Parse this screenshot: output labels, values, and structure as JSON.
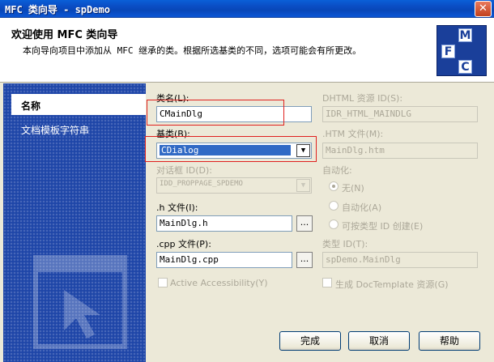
{
  "window": {
    "title": "MFC 类向导 - spDemo"
  },
  "header": {
    "title": "欢迎使用 MFC 类向导",
    "description": "本向导向项目中添加从 MFC 继承的类。根据所选基类的不同，选项可能会有所更改。",
    "logo_letters": [
      "M",
      "F",
      "C"
    ]
  },
  "nav": {
    "items": [
      {
        "label": "名称",
        "selected": true
      },
      {
        "label": "文档模板字符串",
        "selected": false
      }
    ]
  },
  "form": {
    "class_name": {
      "label": "类名(L):",
      "value": "CMainDlg"
    },
    "base_class": {
      "label": "基类(B):",
      "value": "CDialog"
    },
    "dialog_id": {
      "label": "对话框 ID(D):",
      "value": "IDD_PROPPAGE_SPDEMO"
    },
    "h_file": {
      "label": ".h 文件(I):",
      "value": "MainDlg.h",
      "browse": "..."
    },
    "cpp_file": {
      "label": ".cpp 文件(P):",
      "value": "MainDlg.cpp",
      "browse": "..."
    },
    "active_accessibility": {
      "label": "Active Accessibility(Y)",
      "checked": false
    },
    "dhtml_resource_id": {
      "label": "DHTML 资源 ID(S):",
      "value": "IDR_HTML_MAINDLG"
    },
    "htm_file": {
      "label": ".HTM 文件(M):",
      "value": "MainDlg.htm"
    },
    "automation": {
      "label": "自动化:",
      "options": [
        {
          "label": "无(N)",
          "checked": true
        },
        {
          "label": "自动化(A)",
          "checked": false
        },
        {
          "label": "可按类型 ID 创建(E)",
          "checked": false
        }
      ]
    },
    "type_id": {
      "label": "类型 ID(T):",
      "value": "spDemo.MainDlg"
    },
    "generate_doctemplate": {
      "label": "生成 DocTemplate 资源(G)",
      "checked": false
    }
  },
  "buttons": {
    "finish": "完成",
    "cancel": "取消",
    "help": "帮助"
  },
  "colors": {
    "title_bar": "#0a4cc2",
    "left_panel": "#1e46a8",
    "highlight_box": "#e0201e"
  }
}
